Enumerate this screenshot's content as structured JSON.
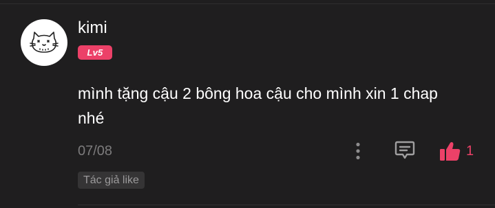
{
  "comment": {
    "username": "kimi",
    "level": "Lv5",
    "text": "mình tặng cậu 2 bông hoa cậu cho mình xin 1 chap nhé",
    "date": "07/08",
    "like_count": "1",
    "author_like_tag": "Tác giả like"
  },
  "icons": {
    "avatar": "cat-avatar-icon",
    "more": "more-vertical-icon",
    "reply": "reply-icon",
    "like": "thumbs-up-icon"
  },
  "colors": {
    "background": "#1f1e1f",
    "accent": "#ec4168",
    "muted_text": "#7c7b7c",
    "tag_background": "#353435"
  }
}
